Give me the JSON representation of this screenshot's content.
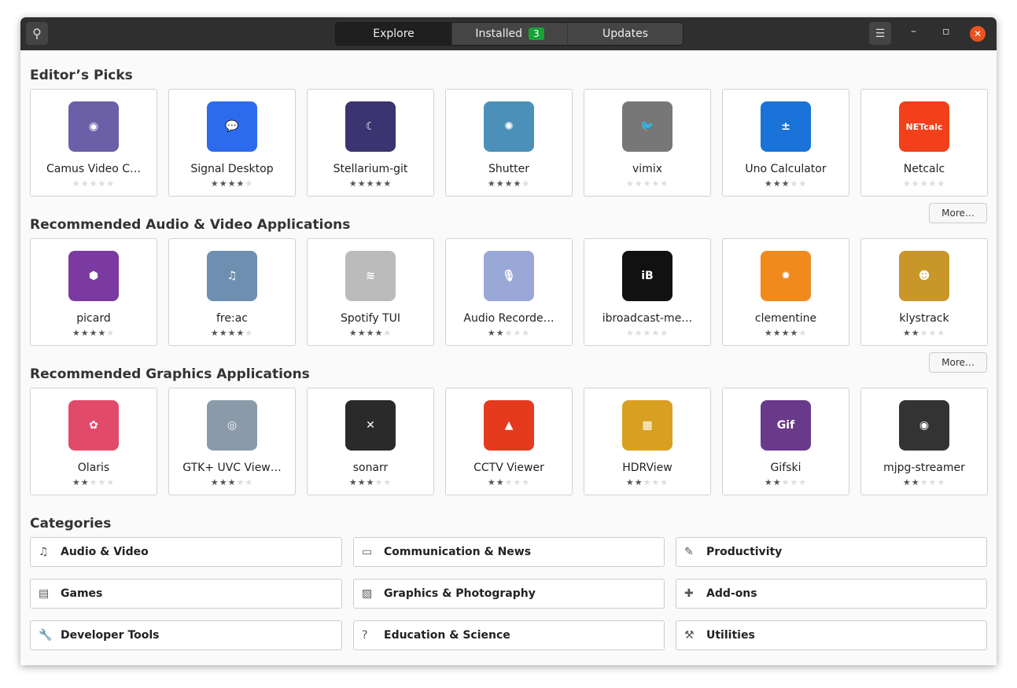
{
  "header": {
    "tabs": [
      {
        "label": "Explore"
      },
      {
        "label": "Installed",
        "badge": "3"
      },
      {
        "label": "Updates"
      }
    ]
  },
  "sections": [
    {
      "title": "Editor’s Picks",
      "apps": [
        {
          "name": "Camus Video C…",
          "rating": 0,
          "color": "#6b5fa8",
          "glyph": "◉"
        },
        {
          "name": "Signal Desktop",
          "rating": 4,
          "color": "#2c6bed",
          "glyph": "💬"
        },
        {
          "name": "Stellarium-git",
          "rating": 5,
          "color": "#3a3470",
          "glyph": "☾"
        },
        {
          "name": "Shutter",
          "rating": 4,
          "color": "#4a90b8",
          "glyph": "✺"
        },
        {
          "name": "vimix",
          "rating": 0,
          "color": "#777",
          "glyph": "🐦"
        },
        {
          "name": "Uno Calculator",
          "rating": 3,
          "color": "#1a73d9",
          "glyph": "±"
        },
        {
          "name": "Netcalc",
          "rating": 0,
          "color": "#f2401b",
          "glyph": "NETcalc"
        }
      ]
    },
    {
      "title": "Recommended Audio & Video Applications",
      "more": "More…",
      "apps": [
        {
          "name": "picard",
          "rating": 4,
          "color": "#7a3aa0",
          "glyph": "⬢"
        },
        {
          "name": "fre:ac",
          "rating": 4,
          "color": "#6f8fb0",
          "glyph": "♫"
        },
        {
          "name": "Spotify TUI",
          "rating": 4,
          "color": "#bbb",
          "glyph": "≋"
        },
        {
          "name": "Audio Recorde…",
          "rating": 2,
          "color": "#9aa8d8",
          "glyph": "🎙"
        },
        {
          "name": "ibroadcast-me…",
          "rating": 0,
          "color": "#111",
          "glyph": "iB"
        },
        {
          "name": "clementine",
          "rating": 4,
          "color": "#f08a1c",
          "glyph": "✹"
        },
        {
          "name": "klystrack",
          "rating": 2,
          "color": "#c9962a",
          "glyph": "☻"
        }
      ]
    },
    {
      "title": "Recommended Graphics Applications",
      "more": "More…",
      "apps": [
        {
          "name": "Olaris",
          "rating": 2,
          "color": "#e24a6a",
          "glyph": "✿"
        },
        {
          "name": "GTK+ UVC View…",
          "rating": 3,
          "color": "#8a9aa8",
          "glyph": "◎"
        },
        {
          "name": "sonarr",
          "rating": 3,
          "color": "#2a2a2a",
          "glyph": "✕"
        },
        {
          "name": "CCTV Viewer",
          "rating": 2,
          "color": "#e63a1e",
          "glyph": "▲"
        },
        {
          "name": "HDRView",
          "rating": 2,
          "color": "#d8a020",
          "glyph": "▦"
        },
        {
          "name": "Gifski",
          "rating": 2,
          "color": "#6a3a8a",
          "glyph": "Gif"
        },
        {
          "name": "mjpg-streamer",
          "rating": 2,
          "color": "#333",
          "glyph": "◉"
        }
      ]
    }
  ],
  "categories": {
    "title": "Categories",
    "items": [
      {
        "label": "Audio & Video",
        "icon": "♫"
      },
      {
        "label": "Communication & News",
        "icon": "▭"
      },
      {
        "label": "Productivity",
        "icon": "✎"
      },
      {
        "label": "Games",
        "icon": "▤"
      },
      {
        "label": "Graphics & Photography",
        "icon": "▨"
      },
      {
        "label": "Add-ons",
        "icon": "✚"
      },
      {
        "label": "Developer Tools",
        "icon": "🔧"
      },
      {
        "label": "Education & Science",
        "icon": "?"
      },
      {
        "label": "Utilities",
        "icon": "⚒"
      }
    ]
  }
}
